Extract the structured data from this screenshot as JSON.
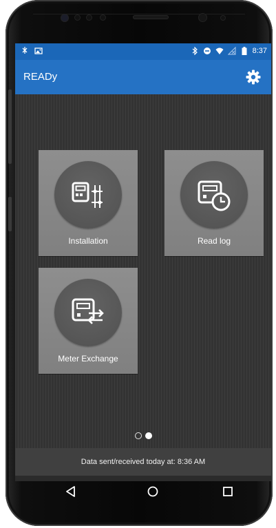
{
  "status_bar": {
    "left_icons": [
      "bluetooth-off-icon",
      "image-notification-icon"
    ],
    "right_icons": [
      "bluetooth-icon",
      "do-not-disturb-icon",
      "wifi-icon",
      "no-sim-icon",
      "battery-icon"
    ],
    "time": "8:37"
  },
  "app_bar": {
    "title": "READy",
    "settings_icon": "gear-icon",
    "color": "#2572c4"
  },
  "tiles": [
    {
      "label": "Installation",
      "icon": "meter-wiring-icon"
    },
    {
      "label": "Read log",
      "icon": "meter-clock-icon"
    },
    {
      "label": "Meter Exchange",
      "icon": "meter-exchange-icon"
    }
  ],
  "pager": {
    "pages": 2,
    "current": 2
  },
  "footer": {
    "text": "Data sent/received today at: 8:36 AM"
  },
  "nav_bar": {
    "buttons": [
      "back-icon",
      "home-icon",
      "recent-apps-icon"
    ]
  }
}
